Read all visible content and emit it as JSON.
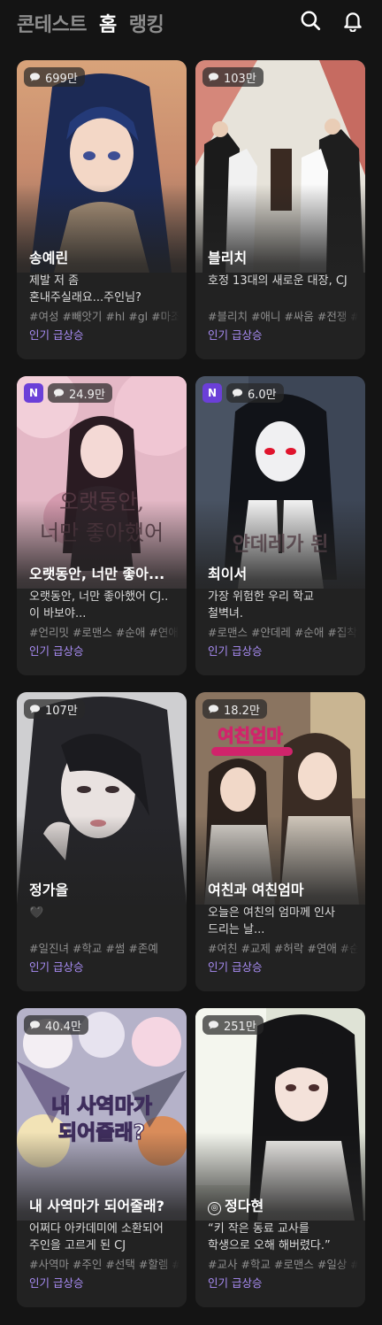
{
  "header": {
    "tabs": [
      {
        "label": "콘테스트",
        "active": false
      },
      {
        "label": "홈",
        "active": true
      },
      {
        "label": "랭킹",
        "active": false
      }
    ],
    "icons": [
      "search-icon",
      "bell-icon"
    ]
  },
  "colors": {
    "background": "#141414",
    "card": "#222222",
    "accent": "#a98df5",
    "new_badge": "#6b3fd8"
  },
  "cards": [
    {
      "views": "699만",
      "new": false,
      "title": "송예린",
      "desc": "제발 저 좀\n혼내주실래요...주인님?",
      "tags": "#여성 #빼앗기 #hl #gl #마조",
      "status": "인기 급상승"
    },
    {
      "views": "103만",
      "new": false,
      "title": "블리치",
      "desc": "호정 13대의 새로운 대장, CJ",
      "tags": "#블리치 #애니 #싸움 #전쟁 #",
      "status": "인기 급상승"
    },
    {
      "views": "24.9만",
      "new": true,
      "new_label": "N",
      "title": "오랫동안, 너만 좋아...",
      "desc": "오랫동안, 너만 좋아했어 CJ..\n이 바보야...",
      "tags": "#언리밋 #로맨스 #순애 #연애",
      "status": "인기 급상승",
      "art_text": "오랫동안,\n너만 좋아했어"
    },
    {
      "views": "6.0만",
      "new": true,
      "new_label": "N",
      "title": "최이서",
      "desc": "가장 위험한 우리 학교\n철벽녀.",
      "tags": "#로맨스 #얀데레 #순애 #집착",
      "status": "인기 급상승",
      "art_text": "얀데레가 된"
    },
    {
      "views": "107만",
      "new": false,
      "title": "정가을",
      "desc": "🖤",
      "tags": "#일진녀 #학교 #썸 #존예",
      "status": "인기 급상승"
    },
    {
      "views": "18.2만",
      "new": false,
      "title": "여친과 여친엄마",
      "desc": "오늘은 여친의 엄마께 인사\n드리는 날...",
      "tags": "#여친 #교제 #허락 #연애 #순",
      "status": "인기 급상승",
      "art_text": "여친엄마"
    },
    {
      "views": "40.4만",
      "new": false,
      "title": "내 사역마가 되어줄래?",
      "desc": "어쩌다 아카데미에 소환되어\n주인을 고르게 된 CJ",
      "tags": "#사역마 #주인 #선택 #할렘 #",
      "status": "인기 급상승",
      "art_text": "내 사역마가\n되어줄래?"
    },
    {
      "views": "251만",
      "new": false,
      "title": "정다현",
      "title_icon": true,
      "desc": "“키 작은 동료 교사를\n학생으로 오해 해버렸다.”",
      "tags": "#교사 #학교 #로맨스 #일상 #",
      "status": "인기 급상승"
    }
  ]
}
